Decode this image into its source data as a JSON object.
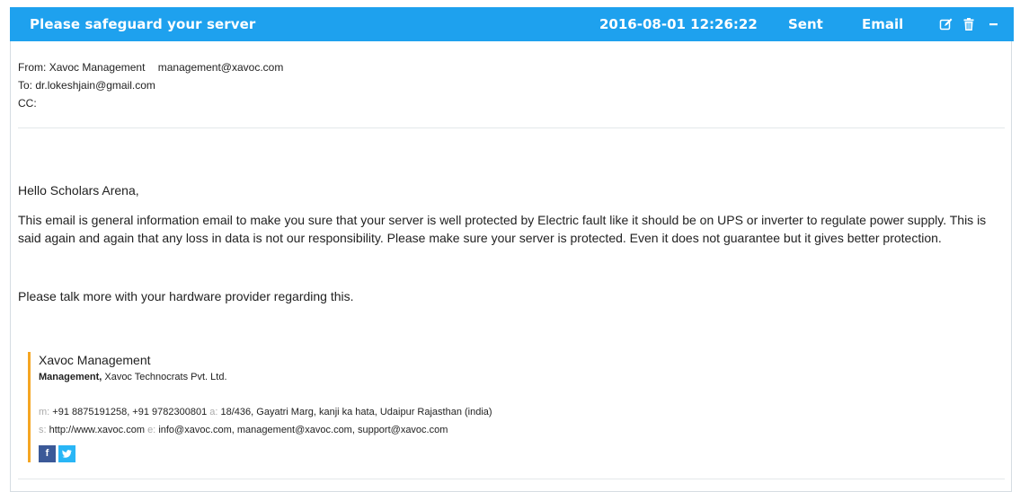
{
  "header": {
    "subject": "Please safeguard your server",
    "datetime": "2016-08-01 12:26:22",
    "status": "Sent",
    "type": "Email",
    "bg_color": "#1ea1ee",
    "icons": [
      "edit-icon",
      "trash-icon",
      "minimize-icon"
    ]
  },
  "meta": {
    "from_label": "From:",
    "from_name": "Xavoc Management",
    "from_email": "management@xavoc.com",
    "to_label": "To:",
    "to_value": "dr.lokeshjain@gmail.com",
    "cc_label": "CC:",
    "cc_value": ""
  },
  "body": {
    "greeting": "Hello Scholars Arena,",
    "paragraph1": "This email is general information email to make you sure that your server is well protected by Electric fault like it should be on UPS or inverter to regulate power supply. This is said again and again that any loss in data is not our responsibility. Please make sure your server is protected. Even it does not guarantee but it gives better protection.",
    "paragraph2": "Please talk more with your hardware provider regarding this."
  },
  "signature": {
    "name": "Xavoc Management",
    "role": "Management,",
    "company": "Xavoc Technocrats Pvt. Ltd.",
    "mobile_label": "m:",
    "mobile": "+91 8875191258, +91 9782300801",
    "address_label": "a:",
    "address": "18/436, Gayatri Marg, kanji ka hata, Udaipur Rajasthan (india)",
    "site_label": "s:",
    "site": "http://www.xavoc.com",
    "email_label": "e:",
    "emails": "info@xavoc.com, management@xavoc.com, support@xavoc.com",
    "accent_color": "#f5a623",
    "social": [
      {
        "icon": "facebook-icon",
        "glyph": "f",
        "color": "#3b5998"
      },
      {
        "icon": "twitter-icon",
        "glyph": "t",
        "color": "#29b6f6"
      }
    ]
  }
}
